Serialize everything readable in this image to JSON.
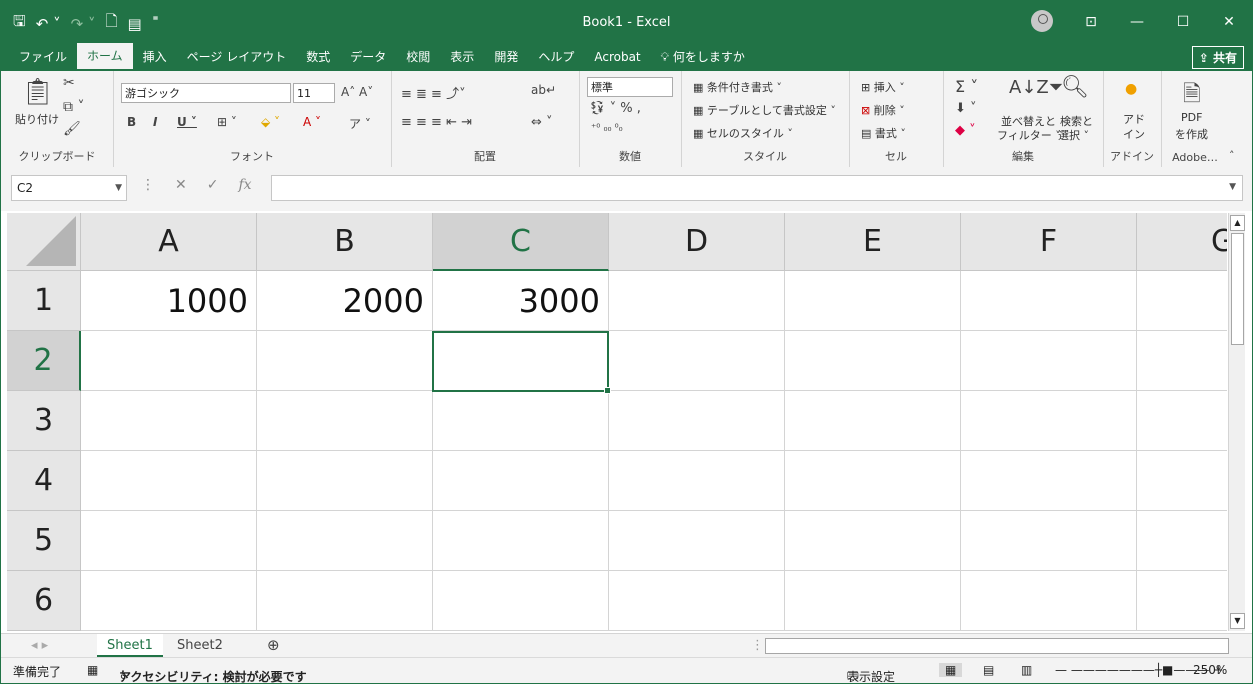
{
  "window": {
    "title": "Book1  -  Excel"
  },
  "menu": {
    "tabs": [
      "ファイル",
      "ホーム",
      "挿入",
      "ページ レイアウト",
      "数式",
      "データ",
      "校閲",
      "表示",
      "開発",
      "ヘルプ",
      "Acrobat"
    ],
    "tell_me": "何をしますか",
    "share": "共有"
  },
  "ribbon": {
    "clipboard": {
      "paste": "貼り付け",
      "label": "クリップボード"
    },
    "font": {
      "name": "游ゴシック",
      "size": "11",
      "label": "フォント"
    },
    "alignment": {
      "label": "配置"
    },
    "number": {
      "format": "標準",
      "label": "数値"
    },
    "styles": {
      "conditional": "条件付き書式",
      "table": "テーブルとして書式設定",
      "cell": "セルのスタイル",
      "label": "スタイル"
    },
    "cells": {
      "insert": "挿入",
      "delete": "削除",
      "format": "書式",
      "label": "セル"
    },
    "editing": {
      "sort": "並べ替えと",
      "sort2": "フィルター",
      "find": "検索と",
      "find2": "選択",
      "label": "編集"
    },
    "addin": {
      "text1": "アド",
      "text2": "イン",
      "label": "アドイン"
    },
    "adobe": {
      "text1": "PDF",
      "text2": "を作成",
      "label": "Adobe…"
    }
  },
  "formula_bar": {
    "name_box": "C2",
    "fx": "fx"
  },
  "sheet": {
    "columns": [
      "A",
      "B",
      "C",
      "D",
      "E",
      "F",
      "G"
    ],
    "rows": [
      "1",
      "2",
      "3",
      "4",
      "5",
      "6"
    ],
    "cells": {
      "A1": "1000",
      "B1": "2000",
      "C1": "3000"
    },
    "active_cell": "C2"
  },
  "tabs": {
    "sheets": [
      "Sheet1",
      "Sheet2"
    ],
    "add": "⊕"
  },
  "status": {
    "ready": "準備完了",
    "accessibility": "アクセシビリティ: 検討が必要です",
    "display_settings": "表示設定",
    "zoom": "250%"
  }
}
